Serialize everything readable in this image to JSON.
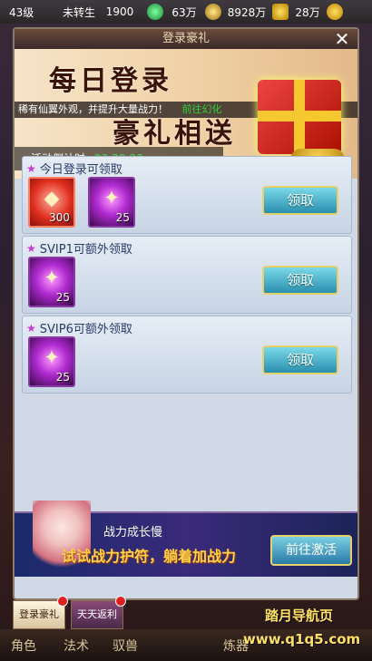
{
  "topbar": {
    "level": "43级",
    "rebirth": "未转生",
    "power": "1900",
    "res1": "63万",
    "res2": "8928万",
    "res3": "28万",
    "colors": {
      "green_coin": "#2fbf6a",
      "gold_coin": "#e8b430"
    }
  },
  "panel": {
    "title": "登录豪礼",
    "close_icon": "close-icon",
    "banner": {
      "title_line1": "每日登录",
      "title_line2": "豪礼相送",
      "ticker_text": "稀有仙翼外观，并提升大量战力！",
      "ticker_link": "前往幻化",
      "countdown_label": "活动倒计时:",
      "countdown_value": "23:22:23"
    },
    "rows": [
      {
        "label": "今日登录可领取",
        "items": [
          {
            "icon": "gold-ingot-icon",
            "count": "300",
            "rarity": "red"
          },
          {
            "icon": "purple-orb-icon",
            "count": "25",
            "rarity": "purple"
          }
        ],
        "button": "领取"
      },
      {
        "label": "SVIP1可额外领取",
        "items": [
          {
            "icon": "purple-orb-icon",
            "count": "25",
            "rarity": "purple"
          }
        ],
        "button": "领取"
      },
      {
        "label": "SVIP6可额外领取",
        "items": [
          {
            "icon": "purple-orb-icon",
            "count": "25",
            "rarity": "purple"
          }
        ],
        "button": "领取"
      }
    ],
    "promo": {
      "title": "战力成长慢",
      "slogan": "试试战力护符，躺着加战力",
      "button": "前往激活"
    }
  },
  "tabs": [
    {
      "label": "登录豪礼",
      "has_dot": true
    },
    {
      "label": "天天返利",
      "has_dot": true
    }
  ],
  "bottom_nav": [
    "角色",
    "法术",
    "驭兽",
    "炼器"
  ],
  "watermark": {
    "line1": "踏月导航页",
    "line2": "www.q1q5.com"
  }
}
